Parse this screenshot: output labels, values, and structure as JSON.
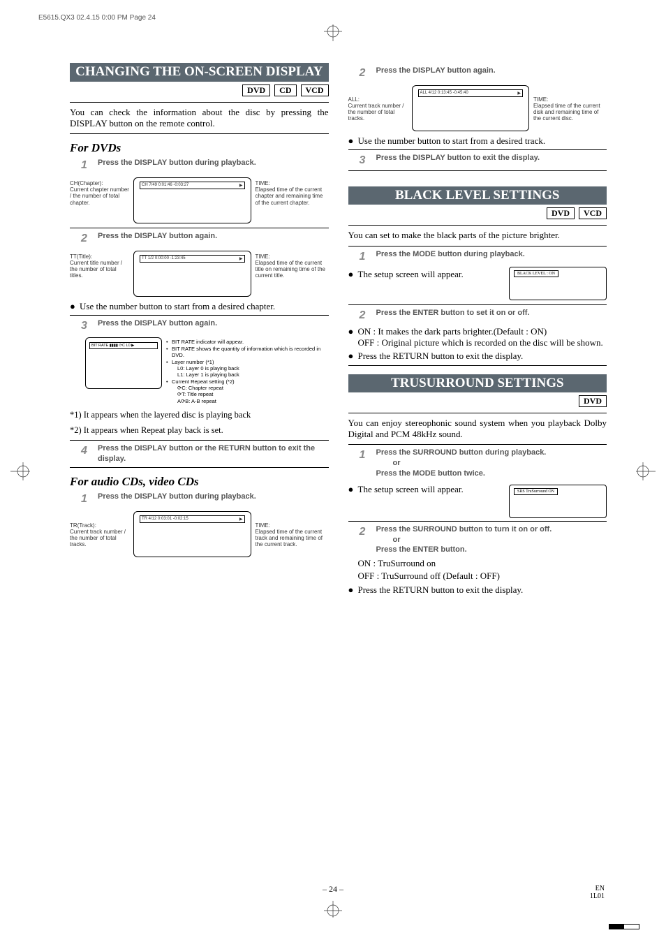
{
  "header": "E5615.QX3  02.4.15 0:00 PM  Page 24",
  "left": {
    "banner": "CHANGING THE ON-SCREEN DISPLAY",
    "tags": [
      "DVD",
      "CD",
      "VCD"
    ],
    "intro": "You can check the information about the disc by pressing the DISPLAY button on the remote control.",
    "sub_dvd": "For DVDs",
    "steps_dvd": {
      "s1": "Press the DISPLAY button during playback.",
      "s2": "Press the DISPLAY button again.",
      "s3": "Press the DISPLAY button again.",
      "s4": "Press the DISPLAY button or the RETURN button to exit the display."
    },
    "diag1": {
      "left_label": "CH(Chapter):",
      "left_text": "Current chapter number / the number of total chapter.",
      "right_label": "TIME:",
      "right_text": "Elapsed time of the current chapter and remaining time of the current chapter.",
      "osd": "CH   7/49   0:01:46 -0:03:27"
    },
    "diag2": {
      "left_label": "TT(Title):",
      "left_text": "Current title number / the number of total titles.",
      "right_label": "TIME:",
      "right_text": "Elapsed time of the current title on remaining time of the current title.",
      "osd": "TT    1/2    0:00:00 -1:23:45"
    },
    "bullet_after2": "Use the number button to start from a desired chapter.",
    "diag3": {
      "osd": "BIT RATE ▮▮▮▮  ⟳C  L0  ▶",
      "lines": [
        "BIT RATE indicator will appear.",
        "BIT RATE shows the quantity of information which is recorded in DVD.",
        "Layer number (*1)",
        "L0: Layer 0 is playing back",
        "L1: Layer 1 is playing back",
        "Current Repeat setting (*2)",
        "⟳C: Chapter repeat",
        "⟳T: Title repeat",
        "A⟳B: A-B repeat"
      ]
    },
    "note1": "*1) It appears when the layered disc is playing back",
    "note2": "*2) It appears when Repeat play back is set.",
    "sub_cd": "For audio CDs, video CDs",
    "steps_cd": {
      "s1": "Press the DISPLAY button during playback."
    },
    "diag_cd1": {
      "left_label": "TR(Track):",
      "left_text": "Current track number / the number of total tracks.",
      "right_label": "TIME:",
      "right_text": "Elapsed time of the current track and remaining time of the current track.",
      "osd": "TR   4/12   0:03:01 -0:02:15"
    }
  },
  "right": {
    "steps_cd_cont": {
      "s2": "Press the DISPLAY button again.",
      "s3": "Press the DISPLAY button to exit the display."
    },
    "diag_cd2": {
      "left_label": "ALL:",
      "left_text": "Current track number / the number of total tracks.",
      "right_label": "TIME:",
      "right_text": "Elapsed time of the current disk and remaining time of the current disc.",
      "osd": "ALL   4/12   0:13:45 -0:45:40"
    },
    "bullet_cd": "Use the number button to start from a desired track.",
    "black": {
      "banner": "BLACK LEVEL SETTINGS",
      "tags": [
        "DVD",
        "VCD"
      ],
      "intro": "You can set to make the black parts of the picture brighter.",
      "s1": "Press the MODE button during playback.",
      "setup": "The setup screen will appear.",
      "osd": "BLACK LEVEL : ON",
      "s2": "Press the ENTER button to set it on or off.",
      "on": "ON : It makes the dark parts brighter.(Default : ON)",
      "off": "OFF : Original picture which is recorded on the disc will be shown.",
      "ret": "Press the RETURN button to exit the display."
    },
    "tru": {
      "banner": "TRUSURROUND SETTINGS",
      "tags": [
        "DVD"
      ],
      "intro": "You can enjoy stereophonic sound system when you playback Dolby Digital and PCM 48kHz sound.",
      "s1a": "Press the SURROUND button during playback.",
      "or": "or",
      "s1b": "Press the MODE button twice.",
      "setup": "The setup screen will appear.",
      "osd": "SRS TruSurround  ON",
      "s2a": "Press the SURROUND button to turn it on or off.",
      "s2b": "Press the ENTER button.",
      "on": "ON : TruSurround on",
      "off": "OFF : TruSurround off (Default : OFF)",
      "ret": "Press the RETURN button to exit the display."
    }
  },
  "page_num": "– 24 –",
  "footer": {
    "l1": "EN",
    "l2": "1L01"
  }
}
